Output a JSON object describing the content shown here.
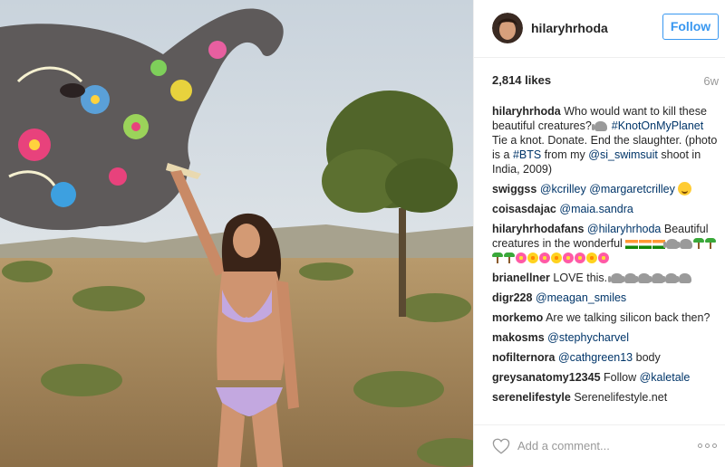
{
  "post": {
    "username": "hilaryhrhoda",
    "follow_label": "Follow",
    "likes": "2,814 likes",
    "age": "6w"
  },
  "comments": [
    {
      "user": "hilaryhrhoda",
      "parts": [
        {
          "t": "text",
          "v": " Who would want to kill these beautiful creatures? "
        },
        {
          "t": "emoji",
          "v": "elephant"
        },
        {
          "t": "text",
          "v": " "
        },
        {
          "t": "tag",
          "v": "#KnotOnMyPlanet"
        },
        {
          "t": "text",
          "v": " Tie a knot. Donate. End the slaughter. (photo is a "
        },
        {
          "t": "tag",
          "v": "#BTS"
        },
        {
          "t": "text",
          "v": " from my "
        },
        {
          "t": "tag",
          "v": "@si_swimsuit"
        },
        {
          "t": "text",
          "v": " shoot in India, 2009)"
        }
      ]
    },
    {
      "user": "swiggss",
      "parts": [
        {
          "t": "text",
          "v": " "
        },
        {
          "t": "tag",
          "v": "@kcrilley"
        },
        {
          "t": "text",
          "v": " "
        },
        {
          "t": "tag",
          "v": "@margaretcrilley"
        },
        {
          "t": "text",
          "v": " "
        },
        {
          "t": "emoji",
          "v": "smile"
        }
      ]
    },
    {
      "user": "coisasdajac",
      "parts": [
        {
          "t": "text",
          "v": " "
        },
        {
          "t": "tag",
          "v": "@maia.sandra"
        }
      ]
    },
    {
      "user": "hilaryhrhodafans",
      "parts": [
        {
          "t": "text",
          "v": " "
        },
        {
          "t": "tag",
          "v": "@hilaryhrhoda"
        },
        {
          "t": "text",
          "v": " Beautiful creatures in the wonderful "
        },
        {
          "t": "emoji",
          "v": "flag"
        },
        {
          "t": "emoji",
          "v": "flag"
        },
        {
          "t": "emoji",
          "v": "flag"
        },
        {
          "t": "emoji",
          "v": "elephant"
        },
        {
          "t": "emoji",
          "v": "elephant"
        },
        {
          "t": "emoji",
          "v": "palm"
        },
        {
          "t": "emoji",
          "v": "palm"
        },
        {
          "t": "emoji",
          "v": "palm"
        },
        {
          "t": "emoji",
          "v": "palm"
        },
        {
          "t": "emoji",
          "v": "flower"
        },
        {
          "t": "emoji",
          "v": "flower-yellow"
        },
        {
          "t": "emoji",
          "v": "flower"
        },
        {
          "t": "emoji",
          "v": "flower-yellow"
        },
        {
          "t": "emoji",
          "v": "flower"
        },
        {
          "t": "emoji",
          "v": "flower"
        },
        {
          "t": "emoji",
          "v": "flower-yellow"
        },
        {
          "t": "emoji",
          "v": "flower"
        }
      ]
    },
    {
      "user": "brianellner",
      "parts": [
        {
          "t": "text",
          "v": " LOVE this. "
        },
        {
          "t": "emoji",
          "v": "elephant"
        },
        {
          "t": "emoji",
          "v": "elephant"
        },
        {
          "t": "emoji",
          "v": "elephant"
        },
        {
          "t": "emoji",
          "v": "elephant"
        },
        {
          "t": "emoji",
          "v": "elephant"
        },
        {
          "t": "emoji",
          "v": "elephant"
        }
      ]
    },
    {
      "user": "digr228",
      "parts": [
        {
          "t": "text",
          "v": " "
        },
        {
          "t": "tag",
          "v": "@meagan_smiles"
        }
      ]
    },
    {
      "user": "morkemo",
      "parts": [
        {
          "t": "text",
          "v": " Are we talking silicon back then?"
        }
      ]
    },
    {
      "user": "makosms",
      "parts": [
        {
          "t": "text",
          "v": " "
        },
        {
          "t": "tag",
          "v": "@stephycharvel"
        }
      ]
    },
    {
      "user": "nofilternora",
      "parts": [
        {
          "t": "text",
          "v": " "
        },
        {
          "t": "tag",
          "v": "@cathgreen13"
        },
        {
          "t": "text",
          "v": " body"
        }
      ]
    },
    {
      "user": "greysanatomy12345",
      "parts": [
        {
          "t": "text",
          "v": " Follow "
        },
        {
          "t": "tag",
          "v": "@kaletale"
        }
      ]
    },
    {
      "user": "serenelifestyle",
      "parts": [
        {
          "t": "text",
          "v": " Serenelifestyle.net"
        }
      ]
    }
  ],
  "comment_box": {
    "placeholder": "Add a comment...",
    "like_icon": "heart-outline-icon",
    "more_icon": "more-options-icon"
  },
  "colors": {
    "accent": "#3897f0",
    "tag": "#003569",
    "muted": "#999999",
    "text": "#262626"
  }
}
